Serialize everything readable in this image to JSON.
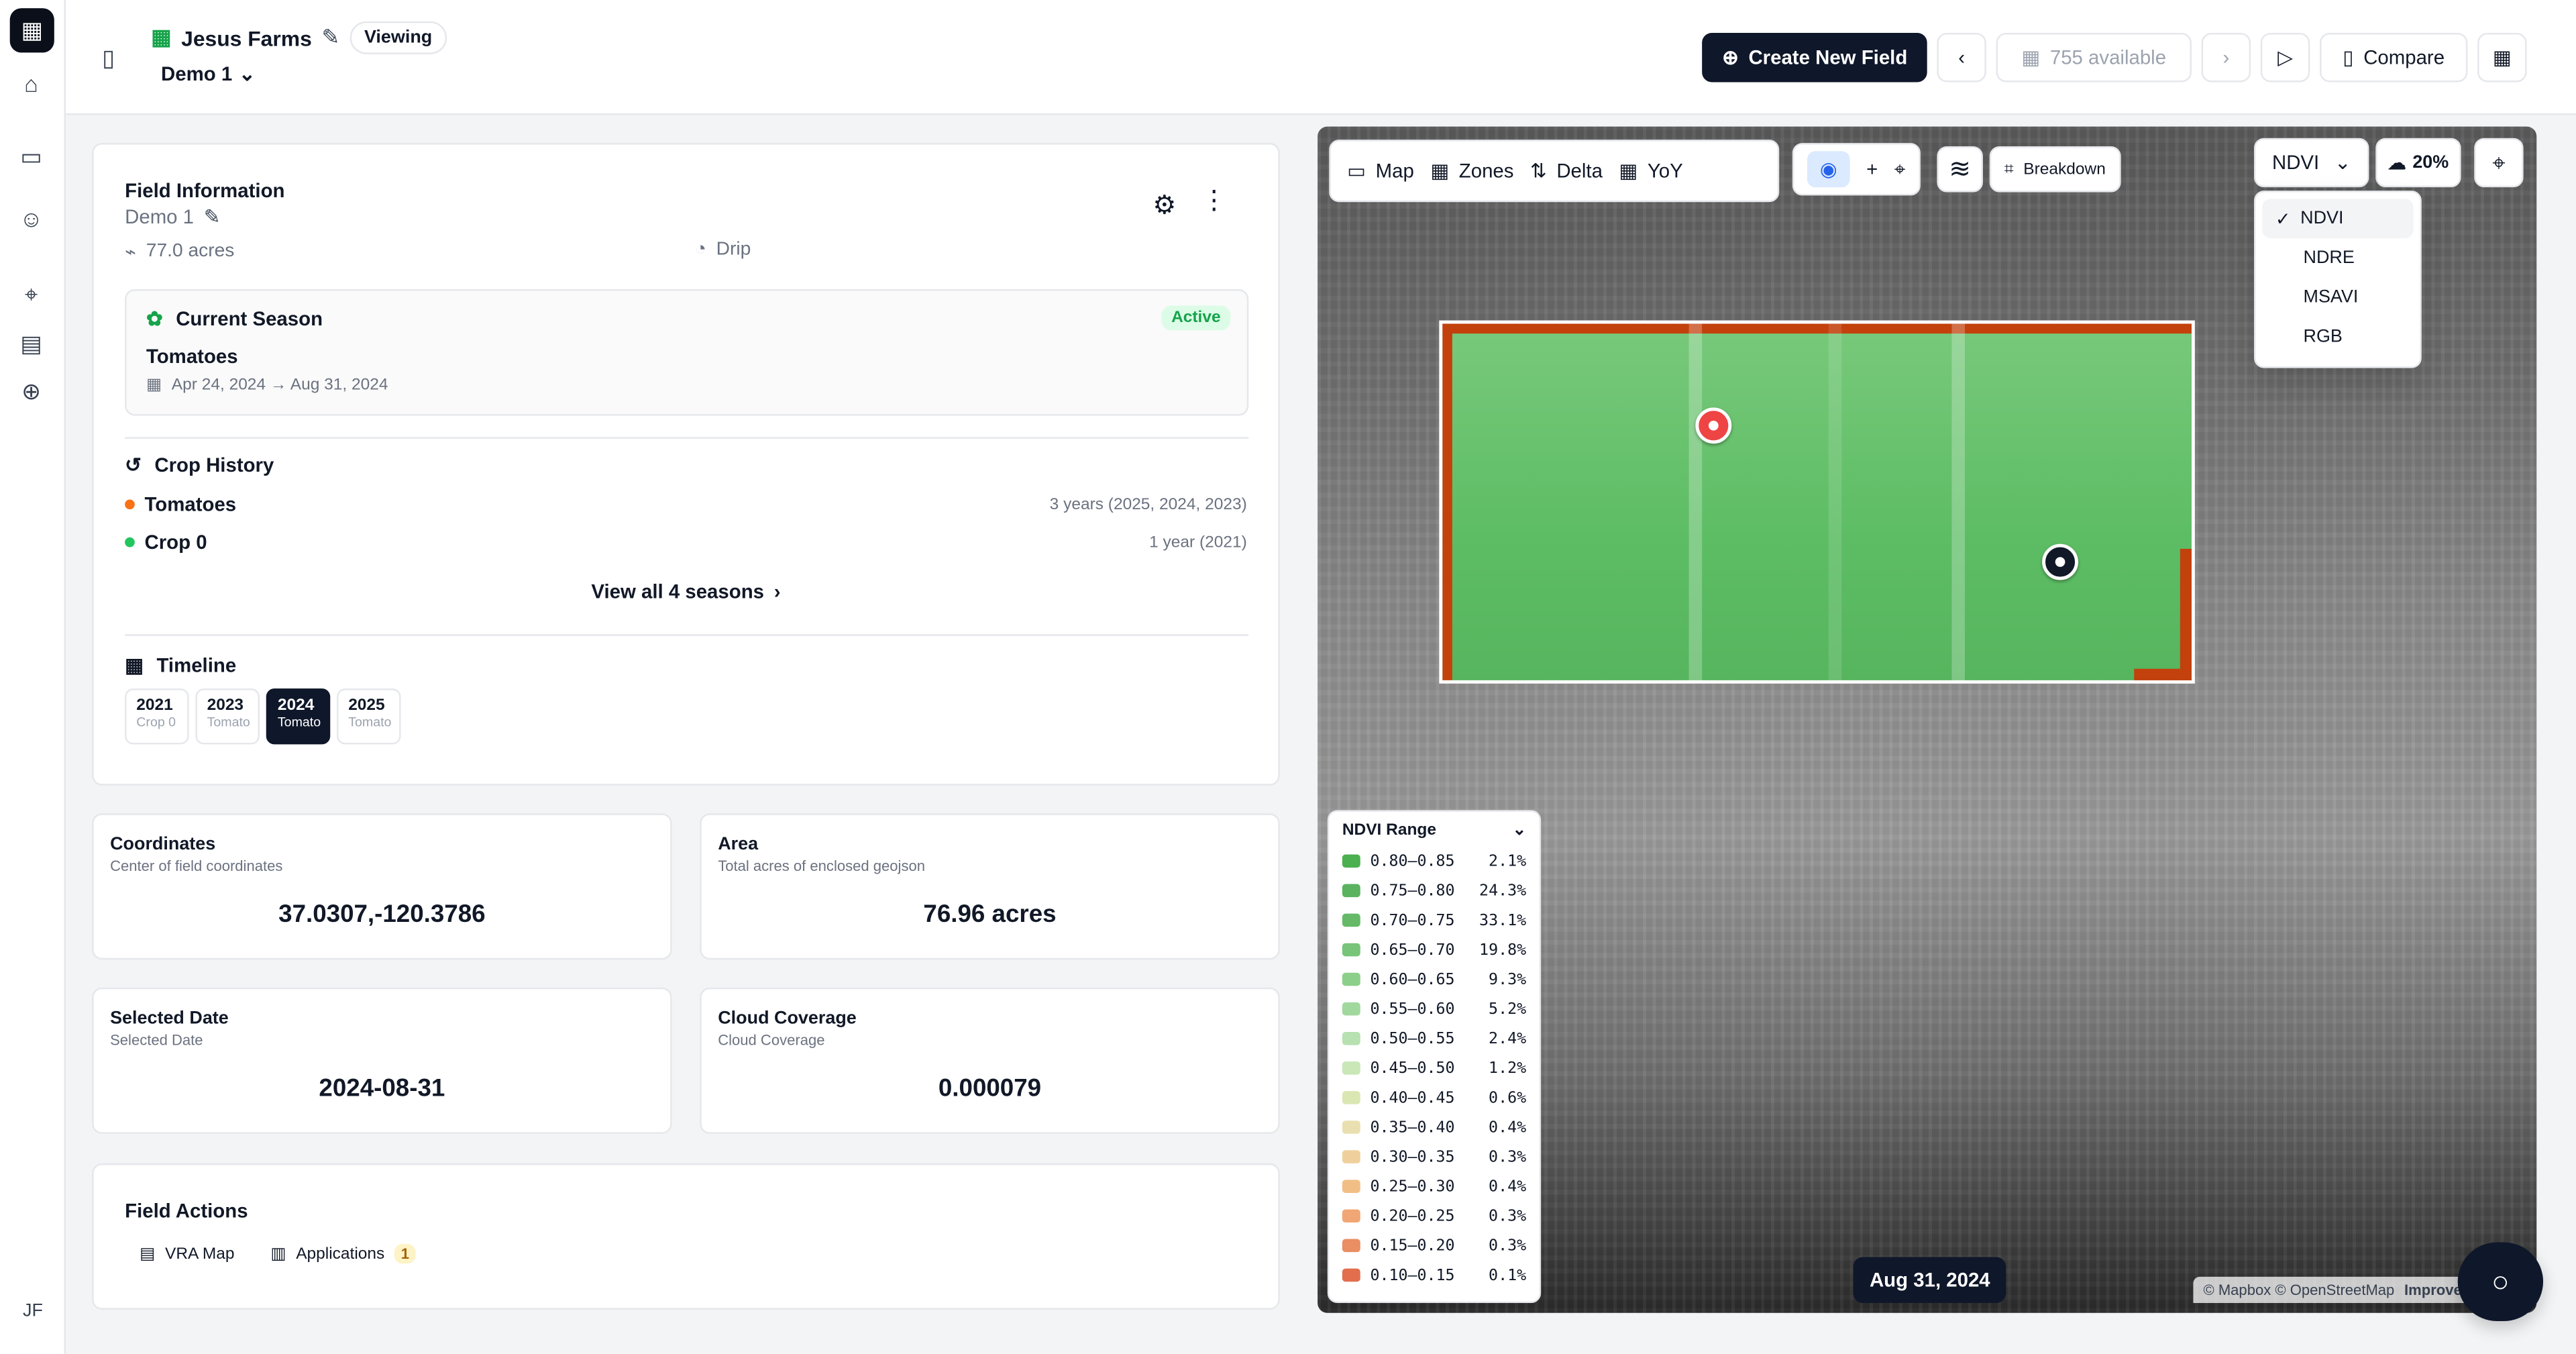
{
  "app": {
    "farm_name": "Jesus Farms",
    "status": "Viewing",
    "field_selector": "Demo 1",
    "user_initials": "JF"
  },
  "toolbar": {
    "create_field": "Create New Field",
    "available": "755 available",
    "compare": "Compare"
  },
  "field_info": {
    "title": "Field Information",
    "field_name": "Demo 1",
    "acres": "77.0 acres",
    "irrigation": "Drip"
  },
  "current_season": {
    "title": "Current Season",
    "badge": "Active",
    "crop": "Tomatoes",
    "dates": "Apr 24, 2024 → Aug 31, 2024"
  },
  "crop_history": {
    "title": "Crop History",
    "items": [
      {
        "name": "Tomatoes",
        "years": "3 years (2025, 2024, 2023)"
      },
      {
        "name": "Crop 0",
        "years": "1 year (2021)"
      }
    ],
    "view_all": "View all 4 seasons"
  },
  "timeline": {
    "title": "Timeline",
    "years": [
      {
        "year": "2021",
        "crop": "Crop 0"
      },
      {
        "year": "2023",
        "crop": "Tomato"
      },
      {
        "year": "2024",
        "crop": "Tomato"
      },
      {
        "year": "2025",
        "crop": "Tomato"
      }
    ]
  },
  "stats": {
    "coordinates": {
      "title": "Coordinates",
      "subtitle": "Center of field coordinates",
      "value": "37.0307,-120.3786"
    },
    "area": {
      "title": "Area",
      "subtitle": "Total acres of enclosed geojson",
      "value": "76.96 acres"
    },
    "selected_date": {
      "title": "Selected Date",
      "subtitle": "Selected Date",
      "value": "2024-08-31"
    },
    "cloud": {
      "title": "Cloud Coverage",
      "subtitle": "Cloud Coverage",
      "value": "0.000079"
    }
  },
  "field_actions": {
    "title": "Field Actions",
    "vra": "VRA Map",
    "applications": "Applications",
    "applications_count": "1"
  },
  "map": {
    "tabs": [
      "Map",
      "Zones",
      "Delta",
      "YoY"
    ],
    "breakdown": "Breakdown",
    "index": "NDVI",
    "cloud_pct": "20%",
    "index_options": [
      "NDVI",
      "NDRE",
      "MSAVI",
      "RGB"
    ],
    "date": "Aug 31, 2024",
    "attribution": "© Mapbox © OpenStreetMap",
    "improve": "Improve this map"
  },
  "legend": {
    "title": "NDVI Range",
    "rows": [
      {
        "range": "0.80–0.85",
        "pct": "2.1%",
        "color": "#4caf50"
      },
      {
        "range": "0.75–0.80",
        "pct": "24.3%",
        "color": "#5bb35f"
      },
      {
        "range": "0.70–0.75",
        "pct": "33.1%",
        "color": "#66ba67"
      },
      {
        "range": "0.65–0.70",
        "pct": "19.8%",
        "color": "#78c479"
      },
      {
        "range": "0.60–0.65",
        "pct": "9.3%",
        "color": "#8ccf8a"
      },
      {
        "range": "0.55–0.60",
        "pct": "5.2%",
        "color": "#a1d89e"
      },
      {
        "range": "0.50–0.55",
        "pct": "2.4%",
        "color": "#b7e1b1"
      },
      {
        "range": "0.45–0.50",
        "pct": "1.2%",
        "color": "#c9e7b7"
      },
      {
        "range": "0.40–0.45",
        "pct": "0.6%",
        "color": "#dbe7b3"
      },
      {
        "range": "0.35–0.40",
        "pct": "0.4%",
        "color": "#eadfb0"
      },
      {
        "range": "0.30–0.35",
        "pct": "0.3%",
        "color": "#efd09c"
      },
      {
        "range": "0.25–0.30",
        "pct": "0.4%",
        "color": "#f1bf86"
      },
      {
        "range": "0.20–0.25",
        "pct": "0.3%",
        "color": "#f0a775"
      },
      {
        "range": "0.15–0.20",
        "pct": "0.3%",
        "color": "#ea8e63"
      },
      {
        "range": "0.10–0.15",
        "pct": "0.1%",
        "color": "#e36e4d"
      }
    ]
  }
}
